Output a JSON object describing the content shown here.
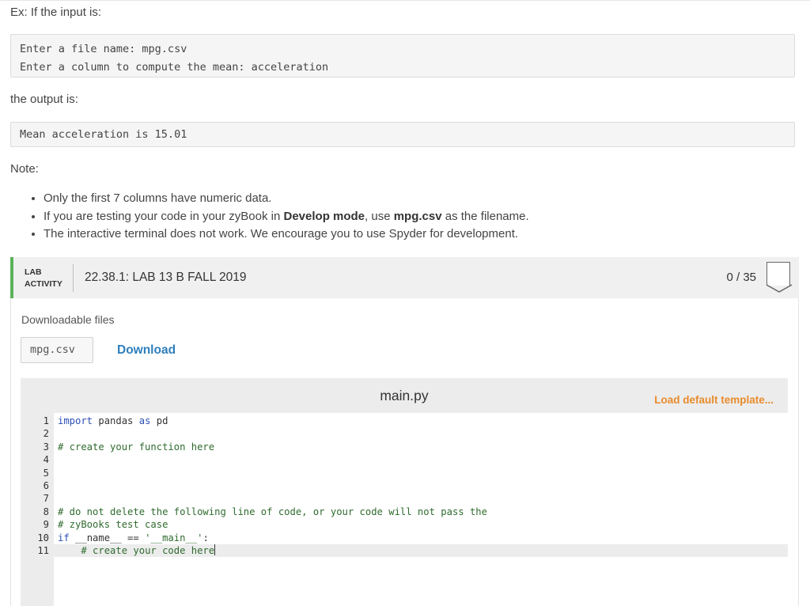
{
  "instructions": {
    "example_intro": "Ex: If the input is:",
    "input_lines": [
      "Enter a file name: mpg.csv",
      "Enter a column to compute the mean: acceleration"
    ],
    "output_intro": "the output is:",
    "output_lines": [
      "Mean acceleration is 15.01"
    ],
    "note_label": "Note:",
    "notes": [
      {
        "parts": [
          "Only the first 7 columns have numeric data."
        ]
      },
      {
        "parts": [
          "If you are testing your code in your zyBook in ",
          "Develop mode",
          ", use ",
          "mpg.csv",
          " as the filename."
        ]
      },
      {
        "parts": [
          "The interactive terminal does not work. We encourage you to use Spyder for development."
        ]
      }
    ]
  },
  "lab": {
    "label_line1": "LAB",
    "label_line2": "ACTIVITY",
    "title": "22.38.1: LAB 13 B FALL 2019",
    "score": "0 / 35",
    "accent_color": "#5ab35a"
  },
  "downloads": {
    "label": "Downloadable files",
    "file_name": "mpg.csv",
    "download_label": "Download"
  },
  "editor": {
    "file_title": "main.py",
    "load_default_label": "Load default template...",
    "lines": [
      {
        "num": "1",
        "text": "import pandas as pd"
      },
      {
        "num": "2",
        "text": ""
      },
      {
        "num": "3",
        "text": "# create your function here"
      },
      {
        "num": "4",
        "text": ""
      },
      {
        "num": "5",
        "text": ""
      },
      {
        "num": "6",
        "text": ""
      },
      {
        "num": "7",
        "text": ""
      },
      {
        "num": "8",
        "text": "# do not delete the following line of code, or your code will not pass the"
      },
      {
        "num": "9",
        "text": "# zyBooks test case"
      },
      {
        "num": "10",
        "text": "if __name__ == '__main__':"
      },
      {
        "num": "11",
        "text": "    # create your code here"
      }
    ],
    "active_line": 11
  }
}
